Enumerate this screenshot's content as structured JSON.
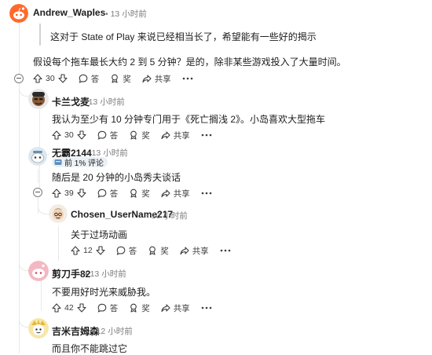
{
  "comments": [
    {
      "username": "Andrew_Waples",
      "time": "13 小时前",
      "quote": "这对于 State of Play 来说已经相当长了，希望能有一些好的揭示",
      "body": "假设每个拖车最长大约 2 到 5 分钟？是的，除非某些游戏投入了大量时间。",
      "votes": "30",
      "reply_label": "答",
      "award_label": "奖",
      "share_label": "共享"
    },
    {
      "username": "卡兰戈麦",
      "time": "13 小时前",
      "body": "我认为至少有 10 分钟专门用于《死亡搁浅 2》。小岛喜欢大型拖车",
      "votes": "30",
      "reply_label": "答",
      "award_label": "奖",
      "share_label": "共享"
    },
    {
      "username": "无霸2144",
      "time": "13 小时前",
      "flair": "前 1% 评论",
      "body": "随后是 20 分钟的小岛秀夫谈话",
      "votes": "39",
      "reply_label": "答",
      "award_label": "奖",
      "share_label": "共享"
    },
    {
      "username": "Chosen_UserName217",
      "time": "10 小时前",
      "body": "关于过场动画",
      "votes": "12",
      "reply_label": "答",
      "award_label": "奖",
      "share_label": "共享"
    },
    {
      "username": "剪刀手82",
      "time": "13 小时前",
      "body": "不要用好时光来威胁我。",
      "votes": "42",
      "reply_label": "答",
      "award_label": "奖",
      "share_label": "共享"
    },
    {
      "username": "吉米吉姆森",
      "time": "12 小时前",
      "body": "而且你不能跳过它"
    }
  ],
  "colors": {
    "upvote": "#3c3c3c",
    "meta": "#7c7c7c",
    "thread": "#e6e8ea",
    "flair_bg": "#eaf0f5"
  }
}
